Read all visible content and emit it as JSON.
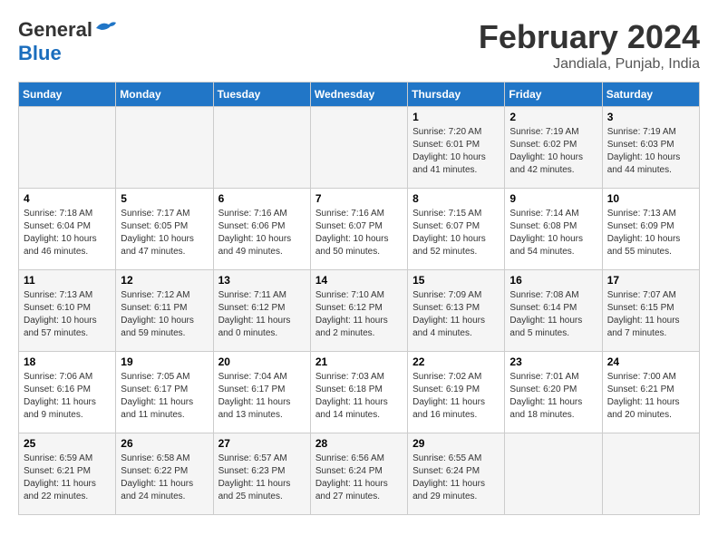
{
  "header": {
    "logo_line1": "General",
    "logo_line2": "Blue",
    "month": "February 2024",
    "location": "Jandiala, Punjab, India"
  },
  "days_of_week": [
    "Sunday",
    "Monday",
    "Tuesday",
    "Wednesday",
    "Thursday",
    "Friday",
    "Saturday"
  ],
  "weeks": [
    [
      {
        "day": "",
        "info": ""
      },
      {
        "day": "",
        "info": ""
      },
      {
        "day": "",
        "info": ""
      },
      {
        "day": "",
        "info": ""
      },
      {
        "day": "1",
        "info": "Sunrise: 7:20 AM\nSunset: 6:01 PM\nDaylight: 10 hours\nand 41 minutes."
      },
      {
        "day": "2",
        "info": "Sunrise: 7:19 AM\nSunset: 6:02 PM\nDaylight: 10 hours\nand 42 minutes."
      },
      {
        "day": "3",
        "info": "Sunrise: 7:19 AM\nSunset: 6:03 PM\nDaylight: 10 hours\nand 44 minutes."
      }
    ],
    [
      {
        "day": "4",
        "info": "Sunrise: 7:18 AM\nSunset: 6:04 PM\nDaylight: 10 hours\nand 46 minutes."
      },
      {
        "day": "5",
        "info": "Sunrise: 7:17 AM\nSunset: 6:05 PM\nDaylight: 10 hours\nand 47 minutes."
      },
      {
        "day": "6",
        "info": "Sunrise: 7:16 AM\nSunset: 6:06 PM\nDaylight: 10 hours\nand 49 minutes."
      },
      {
        "day": "7",
        "info": "Sunrise: 7:16 AM\nSunset: 6:07 PM\nDaylight: 10 hours\nand 50 minutes."
      },
      {
        "day": "8",
        "info": "Sunrise: 7:15 AM\nSunset: 6:07 PM\nDaylight: 10 hours\nand 52 minutes."
      },
      {
        "day": "9",
        "info": "Sunrise: 7:14 AM\nSunset: 6:08 PM\nDaylight: 10 hours\nand 54 minutes."
      },
      {
        "day": "10",
        "info": "Sunrise: 7:13 AM\nSunset: 6:09 PM\nDaylight: 10 hours\nand 55 minutes."
      }
    ],
    [
      {
        "day": "11",
        "info": "Sunrise: 7:13 AM\nSunset: 6:10 PM\nDaylight: 10 hours\nand 57 minutes."
      },
      {
        "day": "12",
        "info": "Sunrise: 7:12 AM\nSunset: 6:11 PM\nDaylight: 10 hours\nand 59 minutes."
      },
      {
        "day": "13",
        "info": "Sunrise: 7:11 AM\nSunset: 6:12 PM\nDaylight: 11 hours\nand 0 minutes."
      },
      {
        "day": "14",
        "info": "Sunrise: 7:10 AM\nSunset: 6:12 PM\nDaylight: 11 hours\nand 2 minutes."
      },
      {
        "day": "15",
        "info": "Sunrise: 7:09 AM\nSunset: 6:13 PM\nDaylight: 11 hours\nand 4 minutes."
      },
      {
        "day": "16",
        "info": "Sunrise: 7:08 AM\nSunset: 6:14 PM\nDaylight: 11 hours\nand 5 minutes."
      },
      {
        "day": "17",
        "info": "Sunrise: 7:07 AM\nSunset: 6:15 PM\nDaylight: 11 hours\nand 7 minutes."
      }
    ],
    [
      {
        "day": "18",
        "info": "Sunrise: 7:06 AM\nSunset: 6:16 PM\nDaylight: 11 hours\nand 9 minutes."
      },
      {
        "day": "19",
        "info": "Sunrise: 7:05 AM\nSunset: 6:17 PM\nDaylight: 11 hours\nand 11 minutes."
      },
      {
        "day": "20",
        "info": "Sunrise: 7:04 AM\nSunset: 6:17 PM\nDaylight: 11 hours\nand 13 minutes."
      },
      {
        "day": "21",
        "info": "Sunrise: 7:03 AM\nSunset: 6:18 PM\nDaylight: 11 hours\nand 14 minutes."
      },
      {
        "day": "22",
        "info": "Sunrise: 7:02 AM\nSunset: 6:19 PM\nDaylight: 11 hours\nand 16 minutes."
      },
      {
        "day": "23",
        "info": "Sunrise: 7:01 AM\nSunset: 6:20 PM\nDaylight: 11 hours\nand 18 minutes."
      },
      {
        "day": "24",
        "info": "Sunrise: 7:00 AM\nSunset: 6:21 PM\nDaylight: 11 hours\nand 20 minutes."
      }
    ],
    [
      {
        "day": "25",
        "info": "Sunrise: 6:59 AM\nSunset: 6:21 PM\nDaylight: 11 hours\nand 22 minutes."
      },
      {
        "day": "26",
        "info": "Sunrise: 6:58 AM\nSunset: 6:22 PM\nDaylight: 11 hours\nand 24 minutes."
      },
      {
        "day": "27",
        "info": "Sunrise: 6:57 AM\nSunset: 6:23 PM\nDaylight: 11 hours\nand 25 minutes."
      },
      {
        "day": "28",
        "info": "Sunrise: 6:56 AM\nSunset: 6:24 PM\nDaylight: 11 hours\nand 27 minutes."
      },
      {
        "day": "29",
        "info": "Sunrise: 6:55 AM\nSunset: 6:24 PM\nDaylight: 11 hours\nand 29 minutes."
      },
      {
        "day": "",
        "info": ""
      },
      {
        "day": "",
        "info": ""
      }
    ]
  ]
}
